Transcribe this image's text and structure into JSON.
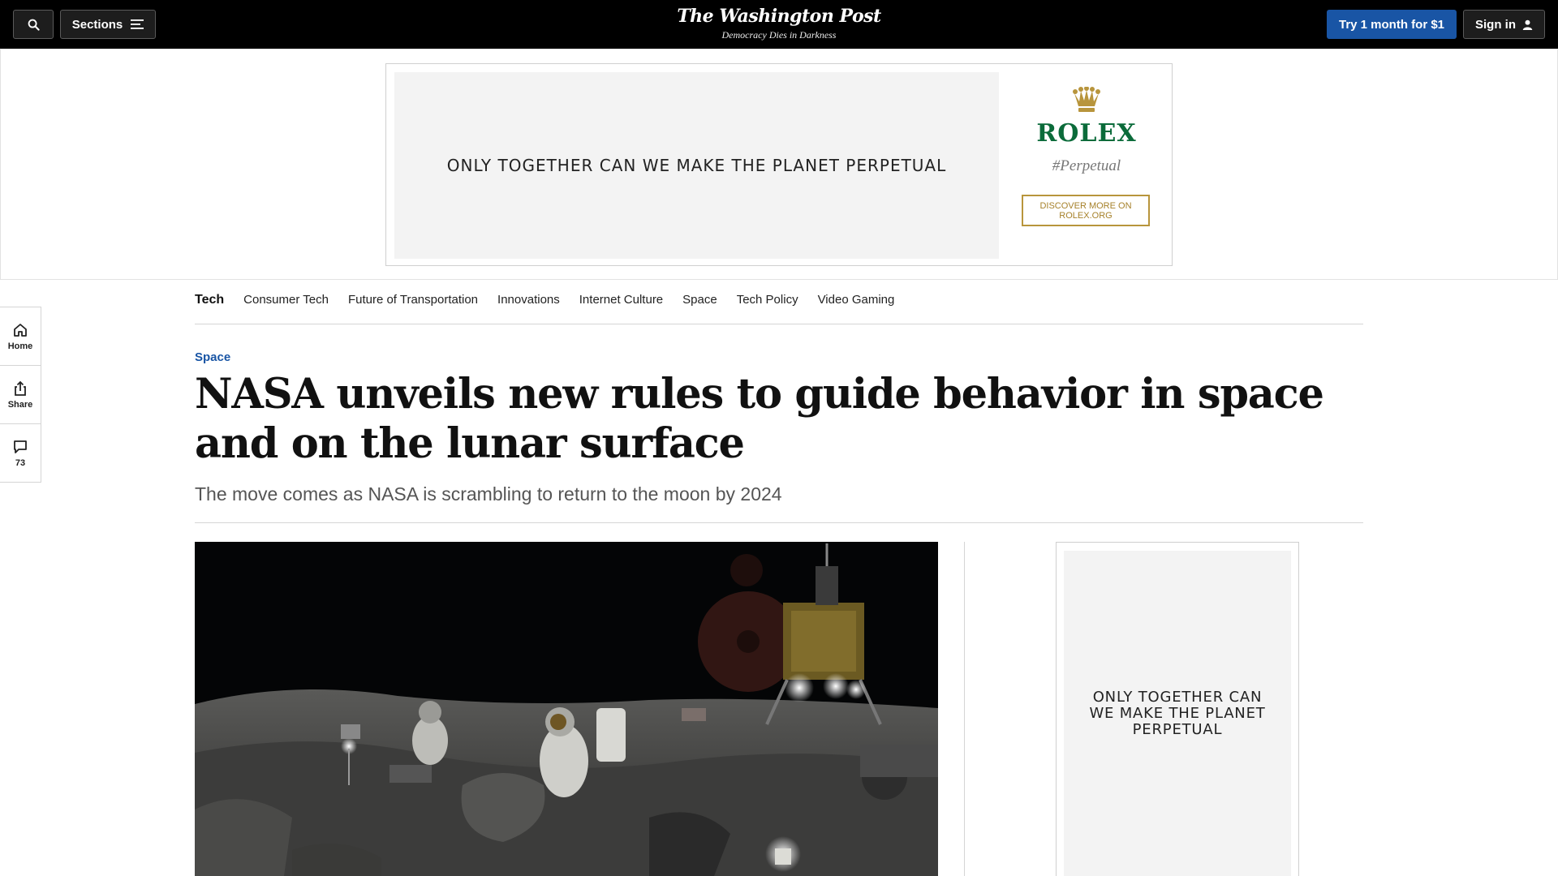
{
  "header": {
    "sections_label": "Sections",
    "logo_name": "The Washington Post",
    "logo_tagline": "Democracy Dies in Darkness",
    "subscribe_label": "Try 1 month for $1",
    "signin_label": "Sign in",
    "accent_color": "#1955a5"
  },
  "top_ad": {
    "slogan": "ONLY TOGETHER CAN WE MAKE THE PLANET PERPETUAL",
    "brand": "ROLEX",
    "hashtag": "#Perpetual",
    "cta": "DISCOVER MORE ON ROLEX.ORG",
    "brand_color": "#0b6b3a"
  },
  "section_nav": {
    "main": "Tech",
    "items": [
      "Consumer Tech",
      "Future of Transportation",
      "Innovations",
      "Internet Culture",
      "Space",
      "Tech Policy",
      "Video Gaming"
    ]
  },
  "left_rail": {
    "home_label": "Home",
    "share_label": "Share",
    "comments_count": "73"
  },
  "article": {
    "kicker": "Space",
    "headline": "NASA unveils new rules to guide behavior in space and on the lunar surface",
    "dek": "The move comes as NASA is scrambling to return to the moon by 2024"
  },
  "right_ad": {
    "slogan": "ONLY TOGETHER CAN WE MAKE THE PLANET PERPETUAL"
  }
}
